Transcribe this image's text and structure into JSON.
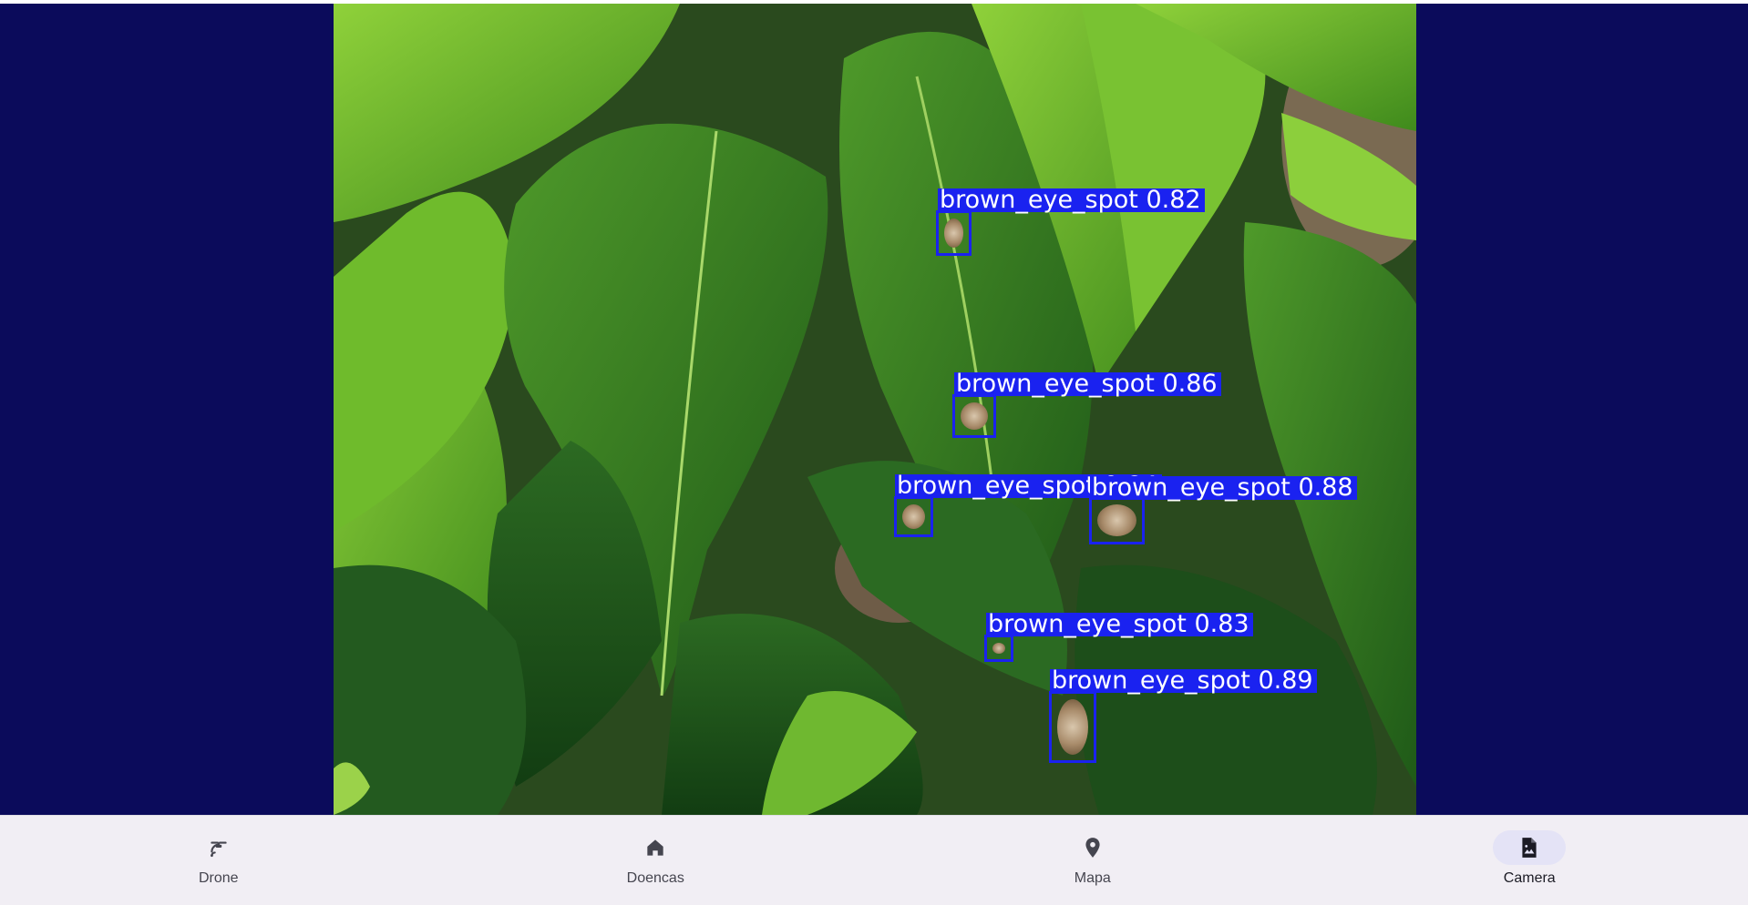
{
  "detections": [
    {
      "label": "brown_eye_spot 0.82"
    },
    {
      "label": "brown_eye_spot 0.86"
    },
    {
      "label": "brown_eye_spot 0.84"
    },
    {
      "label": "brown_eye_spot 0.88"
    },
    {
      "label": "brown_eye_spot 0.83"
    },
    {
      "label": "brown_eye_spot 0.89"
    }
  ],
  "nav": {
    "items": [
      {
        "label": "Drone",
        "icon": "drone-icon"
      },
      {
        "label": "Doencas",
        "icon": "home-icon"
      },
      {
        "label": "Mapa",
        "icon": "map-pin-icon"
      },
      {
        "label": "Camera",
        "icon": "image-file-icon",
        "active": true
      }
    ]
  },
  "colors": {
    "background": "#0b0b5b",
    "detection_box": "#1a22f0",
    "nav_bar": "#f1eef4",
    "active_indicator": "#e4e3f6"
  }
}
